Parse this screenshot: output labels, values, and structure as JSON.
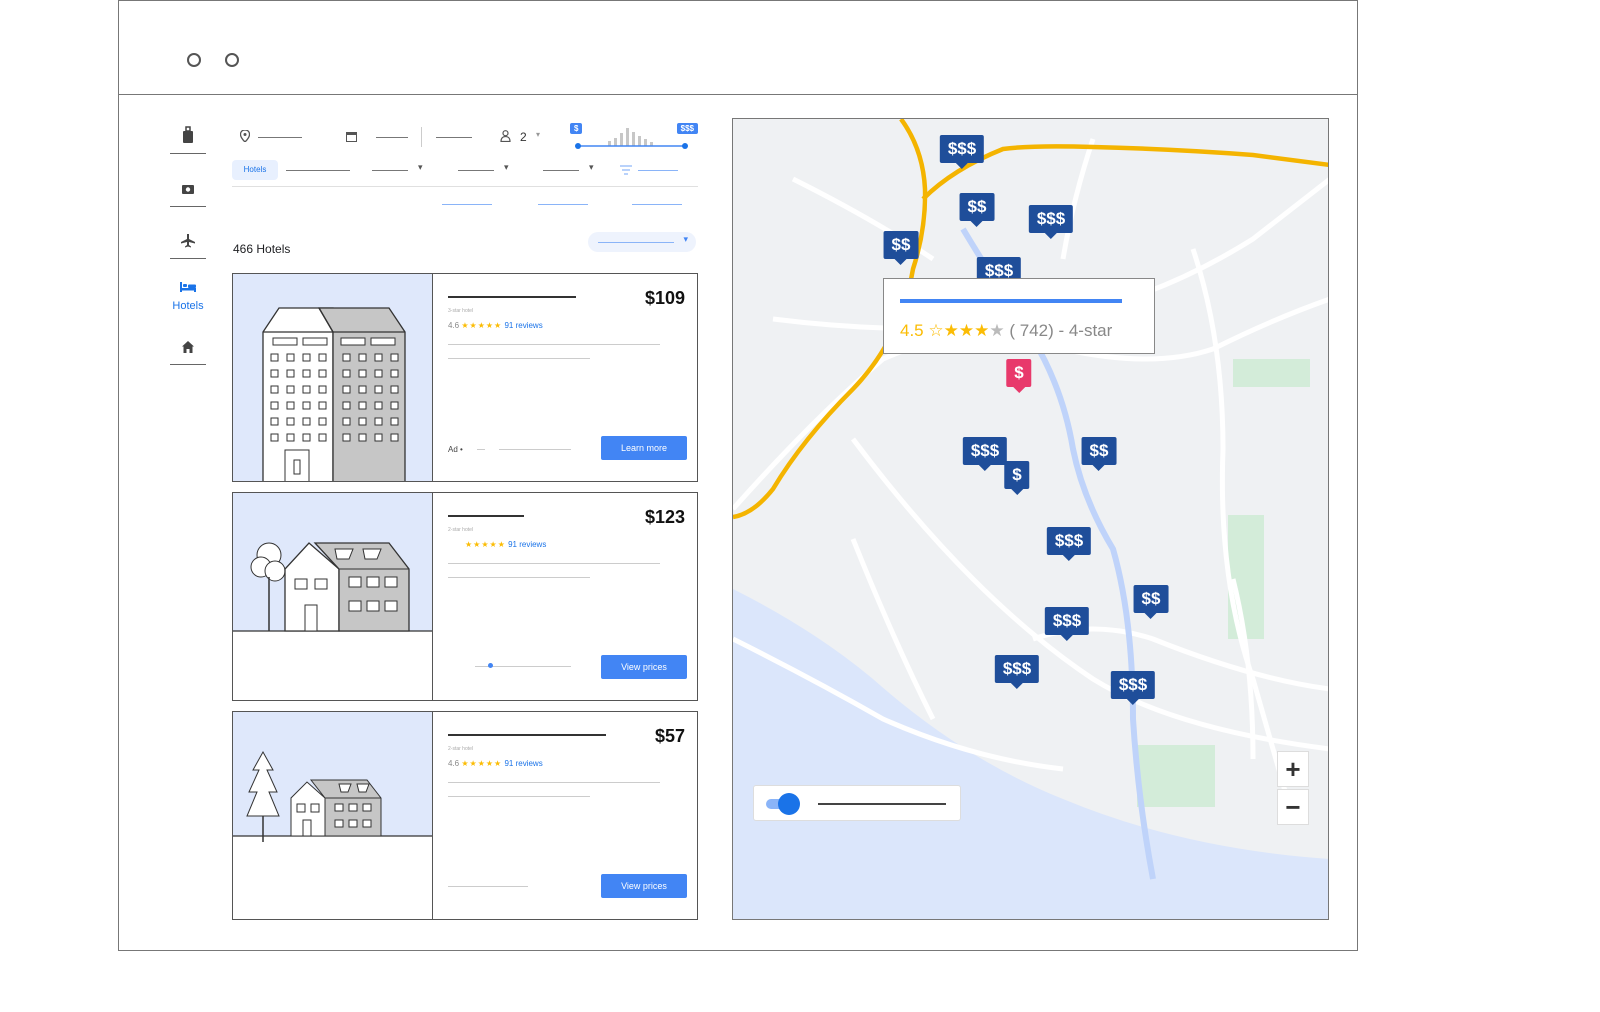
{
  "sidebar": {
    "items": [
      {
        "icon": "suitcase-icon",
        "label": ""
      },
      {
        "icon": "camera-icon",
        "label": ""
      },
      {
        "icon": "airplane-icon",
        "label": ""
      },
      {
        "icon": "bed-icon",
        "label": "Hotels"
      },
      {
        "icon": "home-icon",
        "label": ""
      }
    ]
  },
  "search": {
    "guests": "2",
    "price_min_label": "$",
    "price_max_label": "$$$"
  },
  "filters": {
    "hotels_chip": "Hotels"
  },
  "results": {
    "count_label": "466 Hotels"
  },
  "hotels": [
    {
      "price": "$109",
      "rating": "4.6",
      "stars": "★★★★★",
      "reviews": "91 reviews",
      "subtitle": "3-star hotel",
      "ad_label": "Ad •",
      "button": "Learn more"
    },
    {
      "price": "$123",
      "rating": "",
      "stars": "★★★★★",
      "reviews": "91 reviews",
      "subtitle": "2-star hotel",
      "button": "View prices"
    },
    {
      "price": "$57",
      "rating": "4.6",
      "stars": "★★★★★",
      "reviews": "91 reviews",
      "subtitle": "2-star hotel",
      "button": "View prices"
    }
  ],
  "map": {
    "pins": [
      "$$$",
      "$$",
      "$$$",
      "$$",
      "$$$",
      "$",
      "$$$",
      "$",
      "$$",
      "$$$",
      "$$",
      "$$$",
      "$$$",
      "$$$"
    ],
    "tooltip": {
      "rating": "4.5",
      "reviews_class": "( 742) - 4-star"
    },
    "zoom_in": "+",
    "zoom_out": "−"
  },
  "colors": {
    "accent": "#1a73e8",
    "button": "#4285f4",
    "pin": "#1f4e9a",
    "pin_selected": "#e8396b",
    "road": "#f4b400",
    "water": "#dbe6fb",
    "park": "#d3ecd9"
  }
}
